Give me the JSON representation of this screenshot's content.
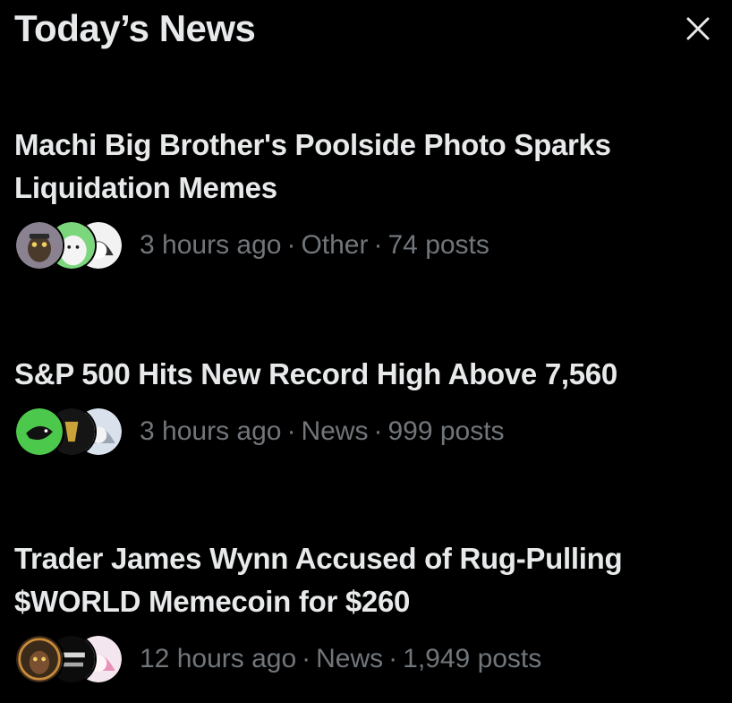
{
  "header": {
    "title": "Today’s News",
    "close_icon": "close-icon"
  },
  "news": [
    {
      "headline": "Machi Big Brother's Poolside Photo Sparks Liquidation Memes",
      "time": "3 hours ago",
      "category": "Other",
      "posts": "74 posts",
      "avatars": [
        "ape-avatar",
        "cartoon-green-avatar",
        "anime-avatar"
      ]
    },
    {
      "headline": "S&P 500 Hits New Record High Above 7,560",
      "time": "3 hours ago",
      "category": "News",
      "posts": "999 posts",
      "avatars": [
        "whale-logo-avatar",
        "gold-logo-avatar",
        "anime-avatar"
      ]
    },
    {
      "headline": "Trader James Wynn Accused of Rug-Pulling $WORLD Memecoin for $260",
      "time": "12 hours ago",
      "category": "News",
      "posts": "1,949 posts",
      "avatars": [
        "ape-avatar",
        "text-logo-avatar",
        "pink-anime-avatar"
      ]
    }
  ],
  "colors": {
    "background": "#000000",
    "text_primary": "#e7e9ea",
    "text_secondary": "#71767b"
  }
}
